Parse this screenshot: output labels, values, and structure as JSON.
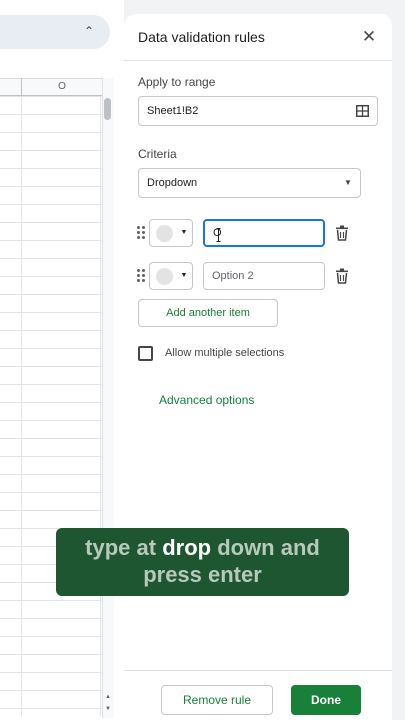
{
  "spreadsheet": {
    "column_header": "O"
  },
  "panel": {
    "title": "Data validation rules",
    "apply_to_range_label": "Apply to range",
    "range_value": "Sheet1!B2",
    "criteria_label": "Criteria",
    "criteria_value": "Dropdown",
    "items": [
      {
        "value": "O",
        "placeholder": "",
        "focused": true
      },
      {
        "value": "",
        "placeholder": "Option 2",
        "focused": false
      }
    ],
    "add_item_label": "Add another item",
    "allow_multiple_label": "Allow multiple selections",
    "allow_multiple_checked": false,
    "advanced_label": "Advanced options",
    "remove_rule_label": "Remove rule",
    "done_label": "Done"
  },
  "caption": {
    "part1": "type at ",
    "part2": "drop",
    "part3": " down and",
    "line2": "press enter"
  },
  "colors": {
    "accent_green": "#188038",
    "focus_blue": "#1a73e8",
    "caption_bg": "#1e5631"
  },
  "icons": {
    "close": "close-icon",
    "grid": "grid-icon",
    "caret": "chevron-down-icon",
    "drag": "drag-handle-icon",
    "trash": "trash-icon"
  }
}
